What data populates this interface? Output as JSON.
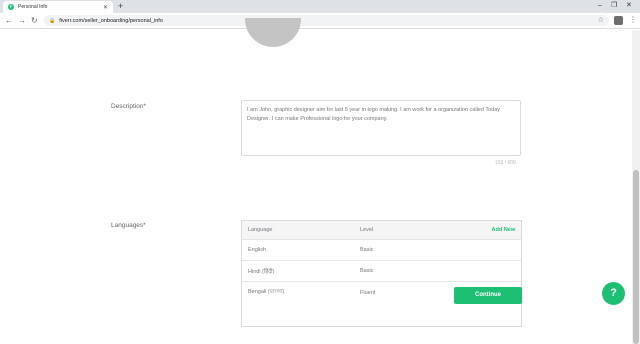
{
  "browser": {
    "tab_title": "Personal Info",
    "tab_favicon": "F",
    "new_tab_label": "+",
    "url": "fiverr.com/seller_onboarding/personal_info",
    "min_glyph": "–",
    "max_glyph": "❐",
    "close_glyph": "✕"
  },
  "form": {
    "description": {
      "label": "Description*",
      "value": "I am John, graphic designer aim for last 5 year in logo making.  I am work for a organization called Today Designer. I can make Professional logo for your company.",
      "counter": "153 / 600"
    },
    "languages": {
      "label": "Languages*",
      "header": {
        "language": "Language",
        "level": "Level",
        "add_new": "Add New"
      },
      "rows": [
        {
          "language": "English",
          "level": "Basic"
        },
        {
          "language": "Hindi (हिंदी)",
          "level": "Basic"
        },
        {
          "language": "Bengali (বাংলা)",
          "level": "Fluent"
        }
      ]
    },
    "continue_label": "Continue"
  },
  "help_label": "?",
  "colors": {
    "accent": "#1dbf73"
  }
}
